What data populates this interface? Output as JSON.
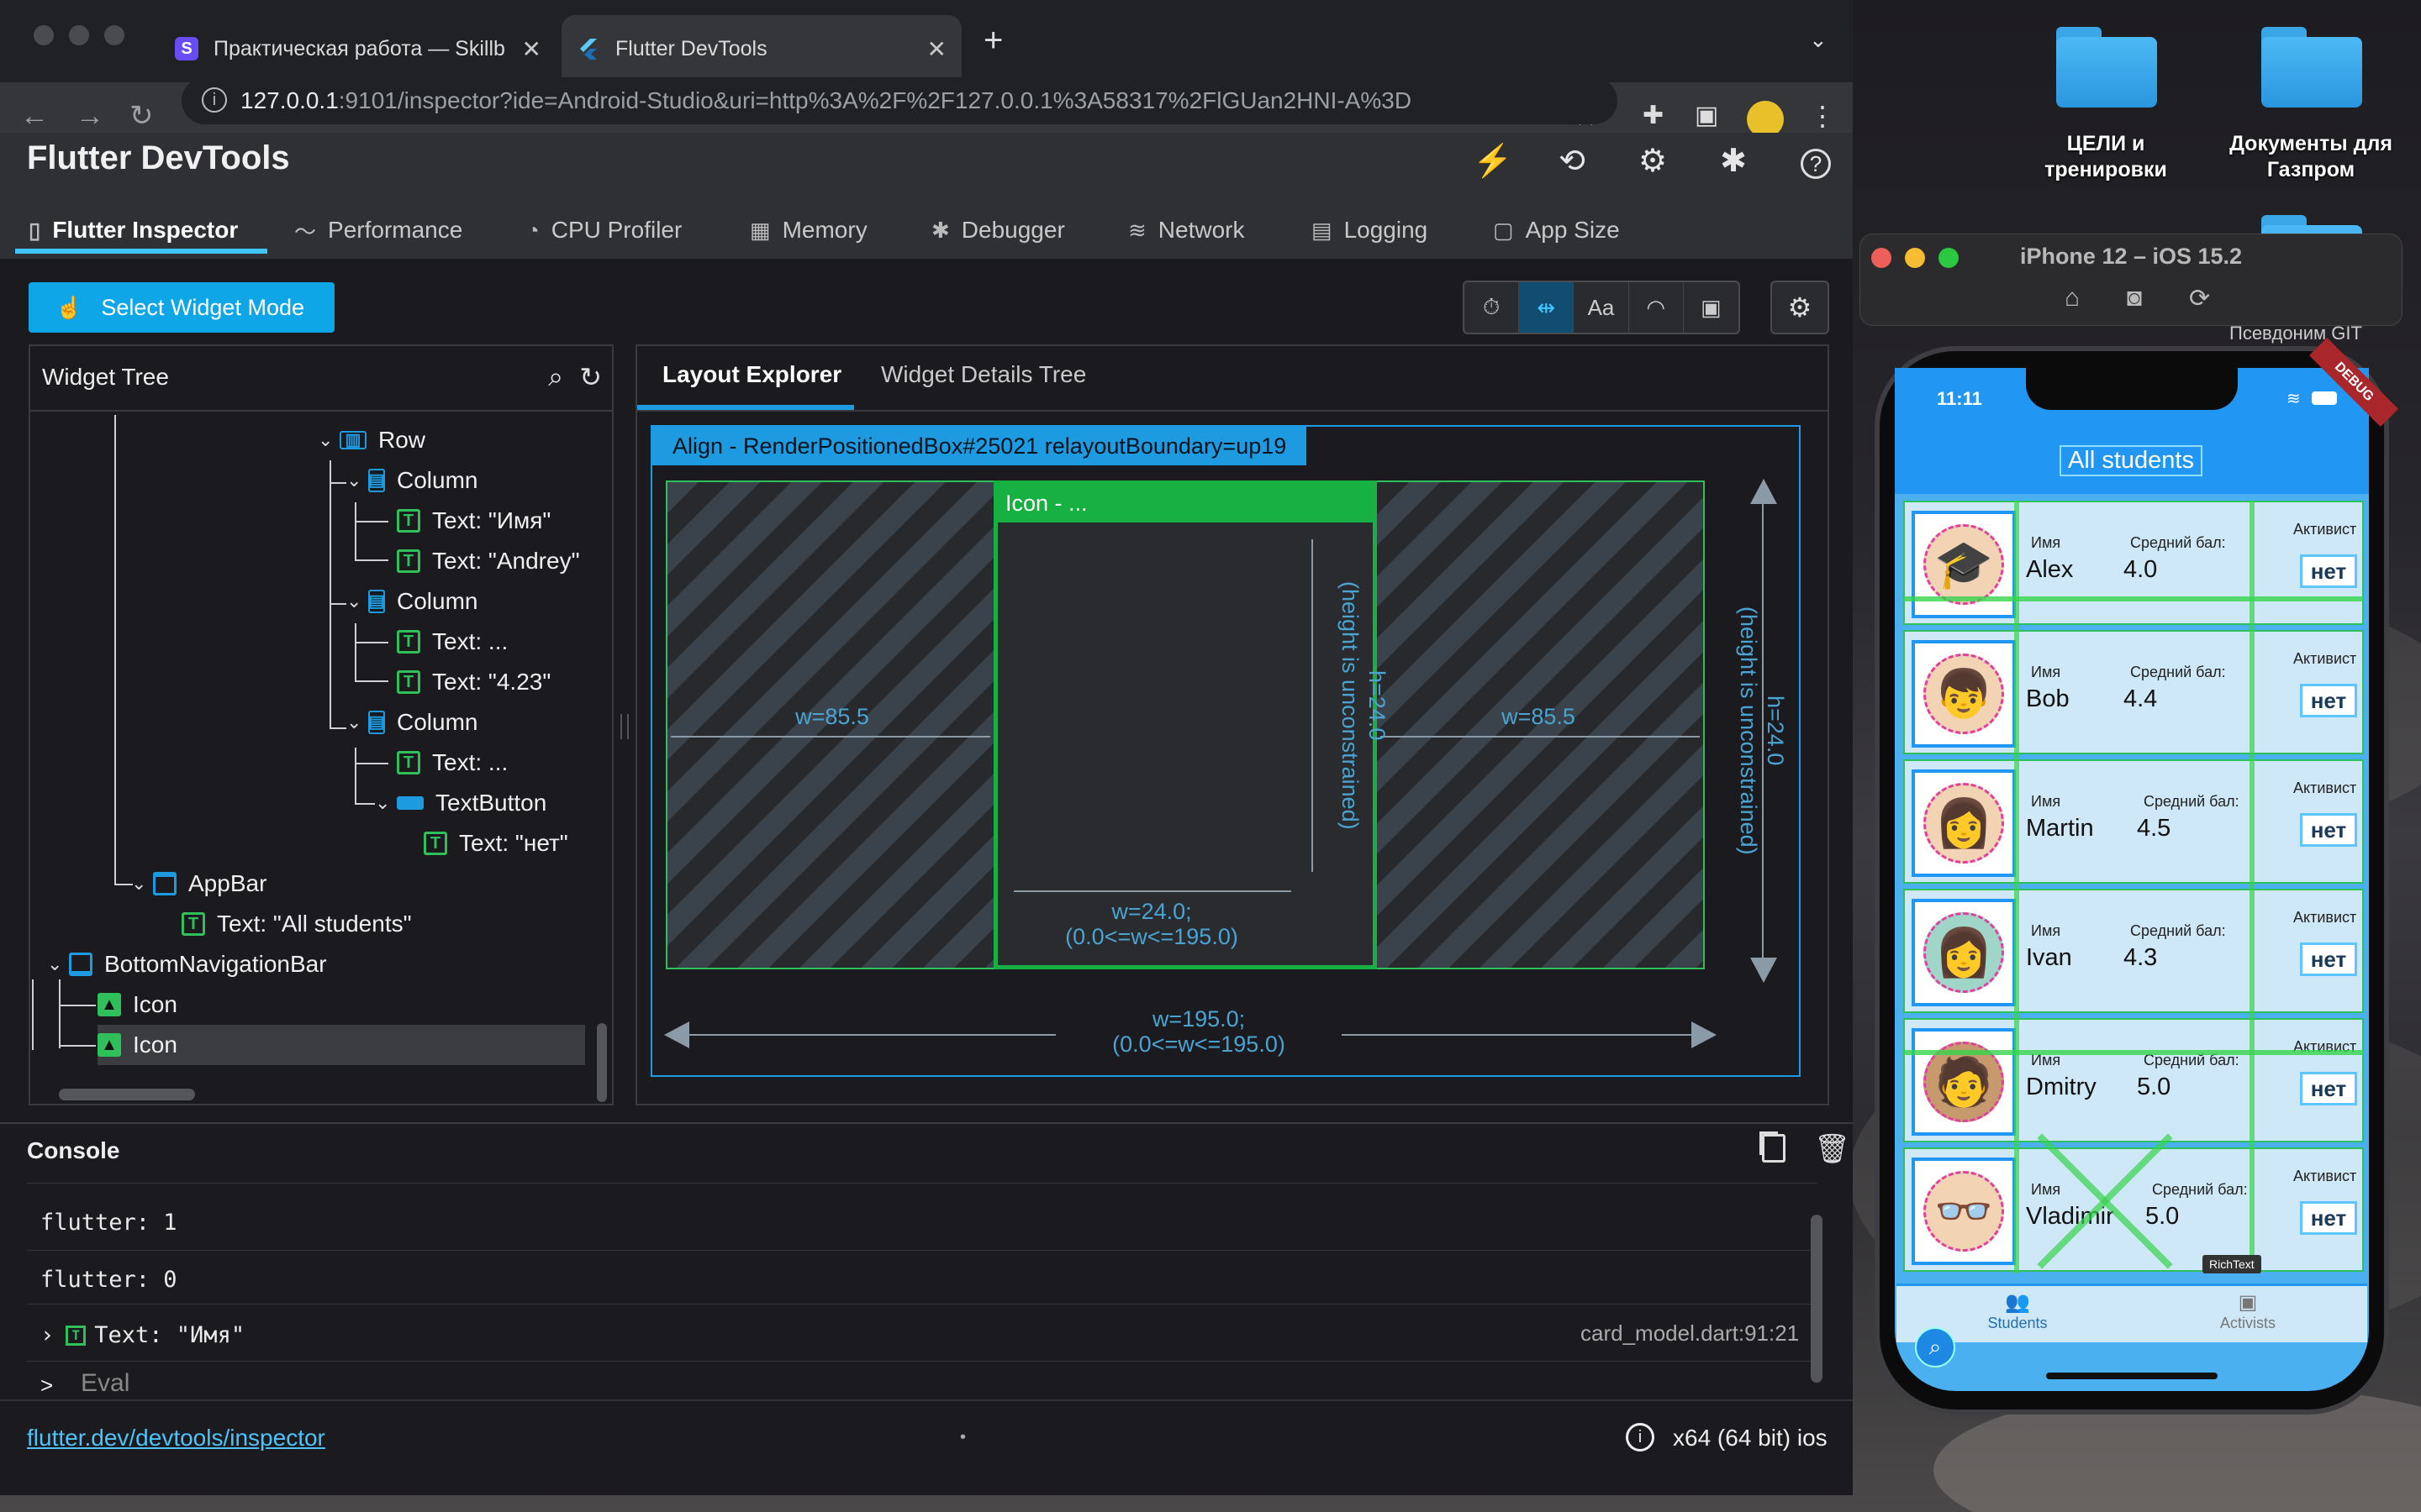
{
  "browser": {
    "tabs": [
      {
        "title": "Практическая работа — Skillb",
        "favicon": "S"
      },
      {
        "title": "Flutter DevTools",
        "favicon": "flutter-icon"
      }
    ],
    "url_host": "127.0.0.1",
    "url_rest": ":9101/inspector?ide=Android-Studio&uri=http%3A%2F%2F127.0.0.1%3A58317%2FlGUan2HNI-A%3D"
  },
  "devtools": {
    "title": "Flutter DevTools",
    "main_tabs": [
      "Flutter Inspector",
      "Performance",
      "CPU Profiler",
      "Memory",
      "Debugger",
      "Network",
      "Logging",
      "App Size"
    ],
    "select_widget_mode": "Select Widget Mode",
    "widget_tree_title": "Widget Tree",
    "tree": [
      {
        "label": "Row"
      },
      {
        "label": "Column"
      },
      {
        "label": "Text: \"Имя\""
      },
      {
        "label": "Text: \"Andrey\""
      },
      {
        "label": "Column"
      },
      {
        "label": "Text: ..."
      },
      {
        "label": "Text: \"4.23\""
      },
      {
        "label": "Column"
      },
      {
        "label": "Text: ..."
      },
      {
        "label": "TextButton"
      },
      {
        "label": "Text: \"нет\""
      },
      {
        "label": "AppBar"
      },
      {
        "label": "Text: \"All students\""
      },
      {
        "label": "BottomNavigationBar"
      },
      {
        "label": "Icon"
      },
      {
        "label": "Icon"
      }
    ],
    "layout_tabs": [
      "Layout Explorer",
      "Widget Details Tree"
    ],
    "layout": {
      "outer_label": "Align - RenderPositionedBox#25021 relayoutBoundary=up19",
      "inner_label": "Icon - ...",
      "left_width": "w=85.5",
      "right_width": "w=85.5",
      "inner_height_1": "h=24.0",
      "inner_height_2": "(height is unconstrained)",
      "inner_width_1": "w=24.0;",
      "inner_width_2": "(0.0<=w<=195.0)",
      "outer_height_1": "h=24.0",
      "outer_height_2": "(height is unconstrained)",
      "outer_width_1": "w=195.0;",
      "outer_width_2": "(0.0<=w<=195.0)"
    },
    "console_title": "Console",
    "console_lines": [
      "flutter: 1",
      "flutter: 0",
      "Text: \"Имя\""
    ],
    "console_source": "card_model.dart:91:21",
    "eval_prompt": ">",
    "eval_placeholder": "Eval",
    "status_link": "flutter.dev/devtools/inspector",
    "status_dot": "•",
    "status_arch": "x64 (64 bit) ios"
  },
  "desktop": {
    "folders": [
      {
        "name": "ЦЕЛИ и тренировки"
      },
      {
        "name": "Документы для Газпром"
      }
    ],
    "git_label": "Псевдоним GIT"
  },
  "simulator": {
    "title": "iPhone 12 – iOS 15.2",
    "time": "11:11",
    "debug_banner": "DEBUG",
    "app_title": "All students",
    "label_name": "Имя",
    "label_score": "Средний бал:",
    "label_activist": "Активист",
    "button_label": "нет",
    "students": [
      {
        "name": "Alex",
        "score": "4.0"
      },
      {
        "name": "Bob",
        "score": "4.4"
      },
      {
        "name": "Martin",
        "score": "4.5"
      },
      {
        "name": "Ivan",
        "score": "4.3"
      },
      {
        "name": "Dmitry",
        "score": "5.0"
      },
      {
        "name": "Vladimir",
        "score": "5.0"
      }
    ],
    "nav_items": [
      "Students",
      "Activists"
    ],
    "tooltip": "RichText"
  }
}
